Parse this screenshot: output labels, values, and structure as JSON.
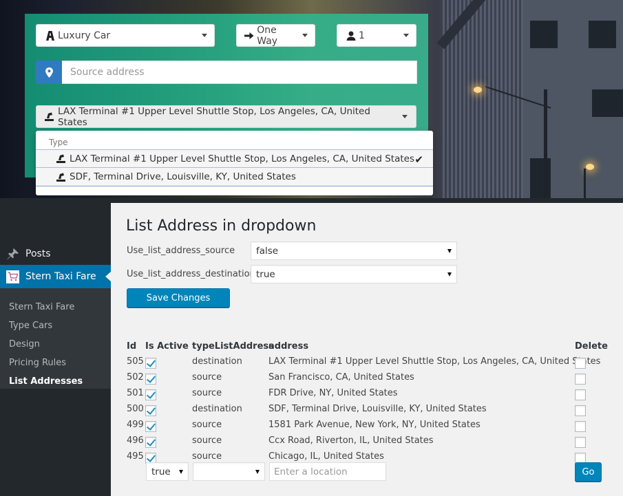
{
  "booking_widget": {
    "car_type": {
      "value": "Luxury Car",
      "icon": "road-icon"
    },
    "trip_type": {
      "value": "One Way",
      "icon": "arrow-right-icon"
    },
    "passengers": {
      "value": "1",
      "icon": "user-icon"
    },
    "source_address": {
      "placeholder": "Source address",
      "value": "",
      "icon": "map-marker-icon"
    },
    "destination": {
      "selected": "LAX Terminal #1 Upper Level Shuttle Stop, Los Angeles, CA, United States",
      "icon": "ticket-icon",
      "menu": {
        "group_header": "Type",
        "options": [
          {
            "label": "LAX Terminal #1 Upper Level Shuttle Stop, Los Angeles, CA, United States",
            "selected": true
          },
          {
            "label": "SDF, Terminal Drive, Louisville, KY, United States",
            "selected": false
          }
        ]
      }
    }
  },
  "sidebar": {
    "posts_label": "Posts",
    "current_menu": "Stern Taxi Fare",
    "submenu": [
      {
        "label": "Stern Taxi Fare",
        "active": false
      },
      {
        "label": "Type Cars",
        "active": false
      },
      {
        "label": "Design",
        "active": false
      },
      {
        "label": "Pricing Rules",
        "active": false
      },
      {
        "label": "List Addresses",
        "active": true
      }
    ]
  },
  "settings": {
    "title": "List Address in dropdown",
    "fields": [
      {
        "label": "Use_list_address_source",
        "value": "false"
      },
      {
        "label": "Use_list_address_destination",
        "value": "true"
      }
    ],
    "save_label": "Save Changes"
  },
  "address_table": {
    "columns": [
      "Id",
      "Is Active",
      "typeListAddress",
      "address",
      "Delete"
    ],
    "rows": [
      {
        "id": "505",
        "active": true,
        "type": "destination",
        "address": "LAX Terminal #1 Upper Level Shuttle Stop, Los Angeles, CA, United States",
        "delete": false
      },
      {
        "id": "502",
        "active": true,
        "type": "source",
        "address": "San Francisco, CA, United States",
        "delete": false
      },
      {
        "id": "501",
        "active": true,
        "type": "source",
        "address": "FDR Drive, NY, United States",
        "delete": false
      },
      {
        "id": "500",
        "active": true,
        "type": "destination",
        "address": "SDF, Terminal Drive, Louisville, KY, United States",
        "delete": false
      },
      {
        "id": "499",
        "active": true,
        "type": "source",
        "address": "1581 Park Avenue, New York, NY, United States",
        "delete": false
      },
      {
        "id": "496",
        "active": true,
        "type": "source",
        "address": "Ccx Road, Riverton, IL, United States",
        "delete": false
      },
      {
        "id": "495",
        "active": true,
        "type": "source",
        "address": "Chicago, IL, United States",
        "delete": false
      }
    ],
    "new_row": {
      "active_value": "true",
      "type_value": "",
      "location_placeholder": "Enter a location",
      "go_label": "Go"
    }
  },
  "colors": {
    "wp_blue": "#0073aa",
    "button_blue": "#0085ba",
    "teal_panel": "#1fa885",
    "addon_blue": "#2f7ac0",
    "sidebar_dark": "#23282d"
  }
}
